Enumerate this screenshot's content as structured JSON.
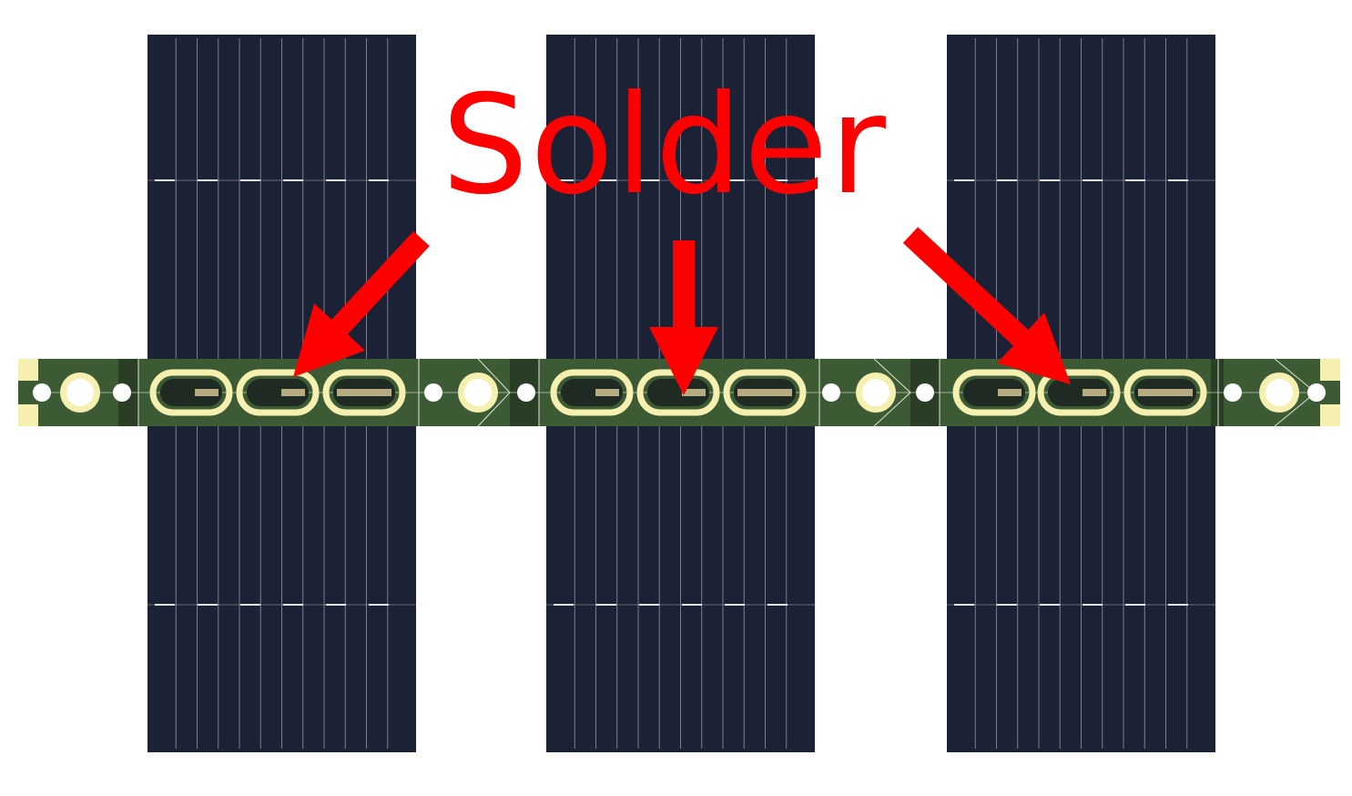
{
  "annotation": {
    "label": "Solder",
    "color": "#ff0000"
  },
  "scene": {
    "background": "#ffffff",
    "cell_color": "#1b2236",
    "cell_line_color": "#c9ccd2",
    "pcb_color": "#3c5a34",
    "pcb_dark_color": "#2a3d25",
    "pad_color": "#f6f0b0",
    "cell_count": 3,
    "arrow_count": 3
  }
}
